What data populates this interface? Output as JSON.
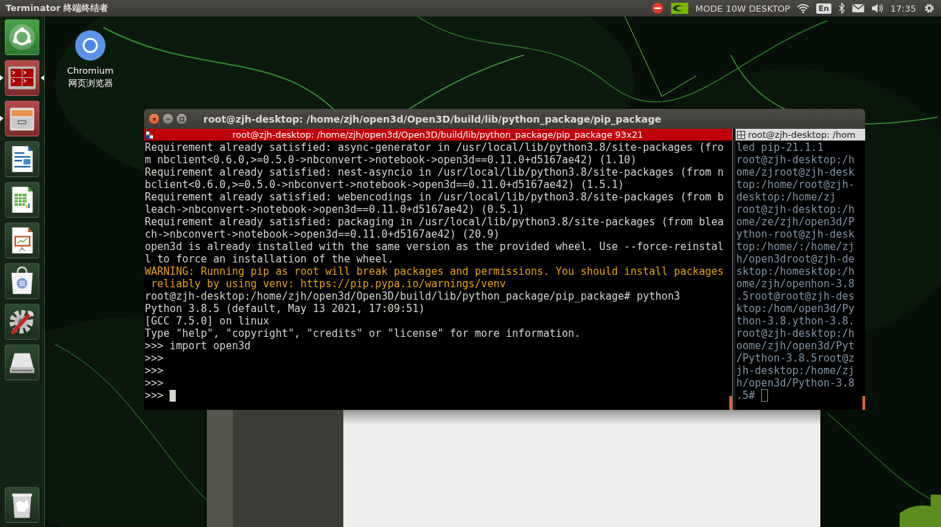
{
  "top_panel": {
    "title": "Terminator 终端终结者",
    "indicators": [
      {
        "kind": "blocked"
      },
      {
        "kind": "gpu"
      },
      {
        "kind": "text",
        "label": "MODE 10W DESKTOP"
      },
      {
        "kind": "wifi"
      },
      {
        "kind": "keyboard",
        "label": "En"
      },
      {
        "kind": "bluetooth"
      },
      {
        "kind": "mail"
      },
      {
        "kind": "volume"
      },
      {
        "kind": "text",
        "label": "17:35"
      },
      {
        "kind": "settings"
      }
    ]
  },
  "launcher": {
    "items": [
      {
        "kind": "dash",
        "running": false,
        "focused": false
      },
      {
        "kind": "terminal",
        "running": true,
        "focused": true
      },
      {
        "kind": "files",
        "running": true,
        "focused": false
      },
      {
        "kind": "writer",
        "running": false,
        "focused": false
      },
      {
        "kind": "calc",
        "running": false,
        "focused": false
      },
      {
        "kind": "impress",
        "running": false,
        "focused": false
      },
      {
        "kind": "store",
        "running": false,
        "focused": false
      },
      {
        "kind": "settings",
        "running": false,
        "focused": false
      },
      {
        "kind": "drive",
        "running": false,
        "focused": false
      }
    ],
    "trash": {
      "kind": "trash",
      "running": false,
      "focused": false
    }
  },
  "desktop_icons": [
    {
      "label": "Chromium 网页浏览器"
    }
  ],
  "terminal_window": {
    "title": "root@zjh-desktop: /home/zjh/open3d/Open3D/build/lib/python_package/pip_package",
    "panes": [
      {
        "header": "root@zjh-desktop: /home/zjh/open3d/Open3D/build/lib/python_package/pip_package 93x21",
        "active": true,
        "lines": [
          {
            "kind": "normal",
            "text": "Requirement already satisfied: async-generator in /usr/local/lib/python3.8/site-packages (fro"
          },
          {
            "kind": "normal",
            "text": "m nbclient<0.6.0,>=0.5.0->nbconvert->notebook->open3d==0.11.0+d5167ae42) (1.10)"
          },
          {
            "kind": "normal",
            "text": "Requirement already satisfied: nest-asyncio in /usr/local/lib/python3.8/site-packages (from n"
          },
          {
            "kind": "normal",
            "text": "bclient<0.6.0,>=0.5.0->nbconvert->notebook->open3d==0.11.0+d5167ae42) (1.5.1)"
          },
          {
            "kind": "normal",
            "text": "Requirement already satisfied: webencodings in /usr/local/lib/python3.8/site-packages (from b"
          },
          {
            "kind": "normal",
            "text": "leach->nbconvert->notebook->open3d==0.11.0+d5167ae42) (0.5.1)"
          },
          {
            "kind": "normal",
            "text": "Requirement already satisfied: packaging in /usr/local/lib/python3.8/site-packages (from blea"
          },
          {
            "kind": "normal",
            "text": "ch->nbconvert->notebook->open3d==0.11.0+d5167ae42) (20.9)"
          },
          {
            "kind": "normal",
            "text": "open3d is already installed with the same version as the provided wheel. Use --force-reinstal"
          },
          {
            "kind": "normal",
            "text": "l to force an installation of the wheel."
          },
          {
            "kind": "warning",
            "text": "WARNING: Running pip as root will break packages and permissions. You should install packages"
          },
          {
            "kind": "warning",
            "text": " reliably by using venv: https://pip.pypa.io/warnings/venv"
          },
          {
            "kind": "normal",
            "text": "root@zjh-desktop:/home/zjh/open3d/Open3D/build/lib/python_package/pip_package# python3"
          },
          {
            "kind": "normal",
            "text": "Python 3.8.5 (default, May 13 2021, 17:09:51)"
          },
          {
            "kind": "normal",
            "text": "[GCC 7.5.0] on linux"
          },
          {
            "kind": "normal",
            "text": "Type \"help\", \"copyright\", \"credits\" or \"license\" for more information."
          },
          {
            "kind": "normal",
            "text": ">>> import open3d"
          },
          {
            "kind": "normal",
            "text": ">>>"
          },
          {
            "kind": "normal",
            "text": ">>>"
          },
          {
            "kind": "normal",
            "text": ">>>"
          },
          {
            "kind": "cursor",
            "text": ">>>"
          }
        ]
      },
      {
        "header": "root@zjh-desktop: /hom",
        "active": false,
        "lines": [
          {
            "kind": "normal",
            "text": "led pip-21.1.1"
          },
          {
            "kind": "normal",
            "text": "root@zjh-desktop:/h"
          },
          {
            "kind": "normal",
            "text": "ome/zjroot@zjh-desk"
          },
          {
            "kind": "normal",
            "text": "top:/home/root@zjh-"
          },
          {
            "kind": "normal",
            "text": "desktop:/home/zj"
          },
          {
            "kind": "normal",
            "text": "root@zjh-desktop:/h"
          },
          {
            "kind": "normal",
            "text": "ome/ze/zjh/open3d/P"
          },
          {
            "kind": "normal",
            "text": "ython-root@zjh-desk"
          },
          {
            "kind": "normal",
            "text": "top:/home/:/home/zj"
          },
          {
            "kind": "normal",
            "text": "h/open3droot@zjh-de"
          },
          {
            "kind": "normal",
            "text": "sktop:/homesktop:/h"
          },
          {
            "kind": "normal",
            "text": "ome/zjh/openhon-3.8"
          },
          {
            "kind": "normal",
            "text": ".5root@root@zjh-des"
          },
          {
            "kind": "normal",
            "text": "ktop:/hom/open3d/Py"
          },
          {
            "kind": "normal",
            "text": "thon-3.8.ython-3.8."
          },
          {
            "kind": "normal",
            "text": "root@zjh-desktop:/h"
          },
          {
            "kind": "normal",
            "text": "oome/zjh/open3d/Pyt"
          },
          {
            "kind": "normal",
            "text": "/Python-3.8.5root@z"
          },
          {
            "kind": "normal",
            "text": "jh-desktop:/home/zj"
          },
          {
            "kind": "normal",
            "text": "h/open3d/Python-3.8"
          },
          {
            "kind": "cursor",
            "text": ".5#"
          }
        ]
      }
    ]
  }
}
